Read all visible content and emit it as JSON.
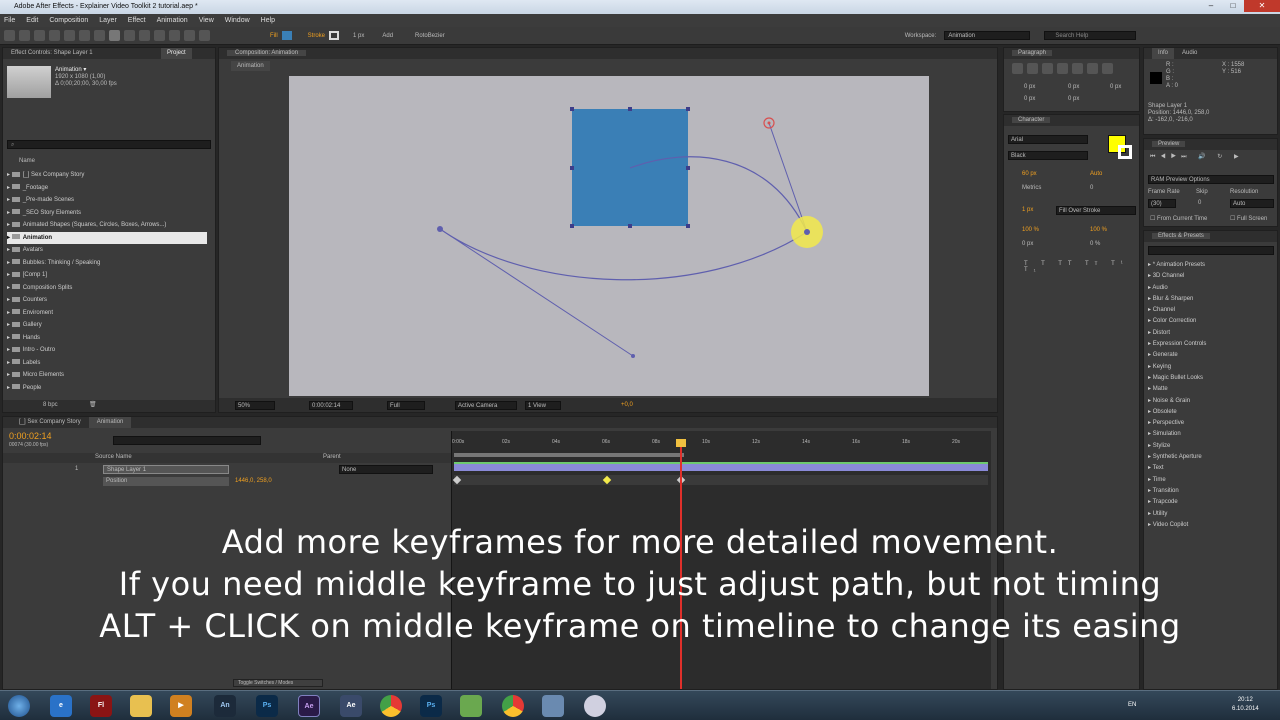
{
  "window": {
    "title": "Adobe After Effects - Explainer Video Toolkit 2 tutorial.aep *"
  },
  "menu": [
    "File",
    "Edit",
    "Composition",
    "Layer",
    "Effect",
    "Animation",
    "View",
    "Window",
    "Help"
  ],
  "toolbar": {
    "fill_label": "Fill",
    "stroke_label": "Stroke",
    "stroke_px": "1 px",
    "add_label": "Add",
    "roto_label": "RotoBezier",
    "workspace_label": "Workspace:",
    "workspace_value": "Animation",
    "search_placeholder": "Search Help"
  },
  "project": {
    "tabs": [
      "Effect Controls: Shape Layer 1",
      "Project"
    ],
    "comp_name": "Animation ▾",
    "comp_info_1": "1920 x 1080 (1,00)",
    "comp_info_2": "Δ 0;00;20;00, 30,00 fps",
    "name_header": "Name",
    "items": [
      "[_] Sex Company Story",
      "_Footage",
      "_Pre-made Scenes",
      "_SEO Story Elements",
      "Animated Shapes (Squares, Circles, Boxes, Arrows...)",
      "Animation",
      "Avatars",
      "Bubbles: Thinking / Speaking",
      "[Comp 1]",
      "Composition Splits",
      "Counters",
      "Enviroment",
      "Gallery",
      "Hands",
      "Intro - Outro",
      "Labels",
      "Micro Elements",
      "People"
    ],
    "selected_index": 5,
    "bpc": "8 bpc"
  },
  "composition": {
    "tab": "Composition: Animation",
    "subtab": "Animation",
    "zoom": "50%",
    "timecode": "0:00:02:14",
    "quality": "Full",
    "camera": "Active Camera",
    "views": "1 View",
    "exposure": "+0,0"
  },
  "paragraph": {
    "tab": "Paragraph",
    "values": [
      "0 px",
      "0 px",
      "0 px",
      "0 px",
      "0 px"
    ]
  },
  "character": {
    "tab": "Character",
    "font": "Arial",
    "style": "Black",
    "size": "60 px",
    "leading": "Auto",
    "kerning": "Metrics",
    "tracking": "0",
    "stroke_w": "1 px",
    "stroke_mode": "Fill Over Stroke",
    "vscale": "100 %",
    "hscale": "100 %",
    "baseline": "0 px",
    "tsume": "0 %",
    "fill_color": "#ffff00"
  },
  "info": {
    "tabs": [
      "Info",
      "Audio"
    ],
    "rgb": [
      "R :",
      "G :",
      "B :",
      "A : 0"
    ],
    "xy": [
      "X : 1558",
      "Y : 516"
    ],
    "layer": "Shape Layer 1",
    "position": "Position: 1446,0, 258,0",
    "delta": "Δ: -162,0, -216,0"
  },
  "preview": {
    "tab": "Preview",
    "ram": "RAM Preview Options",
    "frame_rate_label": "Frame Rate",
    "skip_label": "Skip",
    "resolution_label": "Resolution",
    "frame_rate": "(30)",
    "skip": "0",
    "resolution": "Auto",
    "from_current": "From Current Time",
    "full_screen": "Full Screen"
  },
  "effects": {
    "tab": "Effects & Presets",
    "items": [
      "* Animation Presets",
      "3D Channel",
      "Audio",
      "Blur & Sharpen",
      "Channel",
      "Color Correction",
      "Distort",
      "Expression Controls",
      "Generate",
      "Keying",
      "Magic Bullet Looks",
      "Matte",
      "Noise & Grain",
      "Obsolete",
      "Perspective",
      "Simulation",
      "Stylize",
      "Synthetic Aperture",
      "Text",
      "Time",
      "Transition",
      "Trapcode",
      "Utility",
      "Video Copilot"
    ]
  },
  "timeline": {
    "tabs": [
      "[_] Sex Company Story",
      "Animation"
    ],
    "timecode": "0:00:02:14",
    "fps": "00074 (30.00 fps)",
    "col_source": "Source Name",
    "col_parent": "Parent",
    "layer_index": "1",
    "layer_name": "Shape Layer 1",
    "parent": "None",
    "prop_name": "Position",
    "prop_value": "1446,0, 258,0",
    "ruler": [
      "0:00s",
      "02s",
      "04s",
      "06s",
      "08s",
      "10s",
      "12s",
      "14s",
      "16s",
      "18s",
      "20s"
    ],
    "toggle": "Toggle Switches / Modes"
  },
  "captions": [
    "Add more keyframes for more detailed movement.",
    "If you need middle keyframe to just adjust path, but not timing",
    "ALT + CLICK on middle keyframe on timeline to change its easing"
  ],
  "taskbar": {
    "lang": "EN",
    "time": "20:12",
    "date": "6.10.2014"
  },
  "colors": {
    "square": "#3a7fb6",
    "canvas": "#b8b7bd",
    "path": "#5f5fae",
    "anchor": "#f2ea4b",
    "playhead": "#e0302b"
  }
}
